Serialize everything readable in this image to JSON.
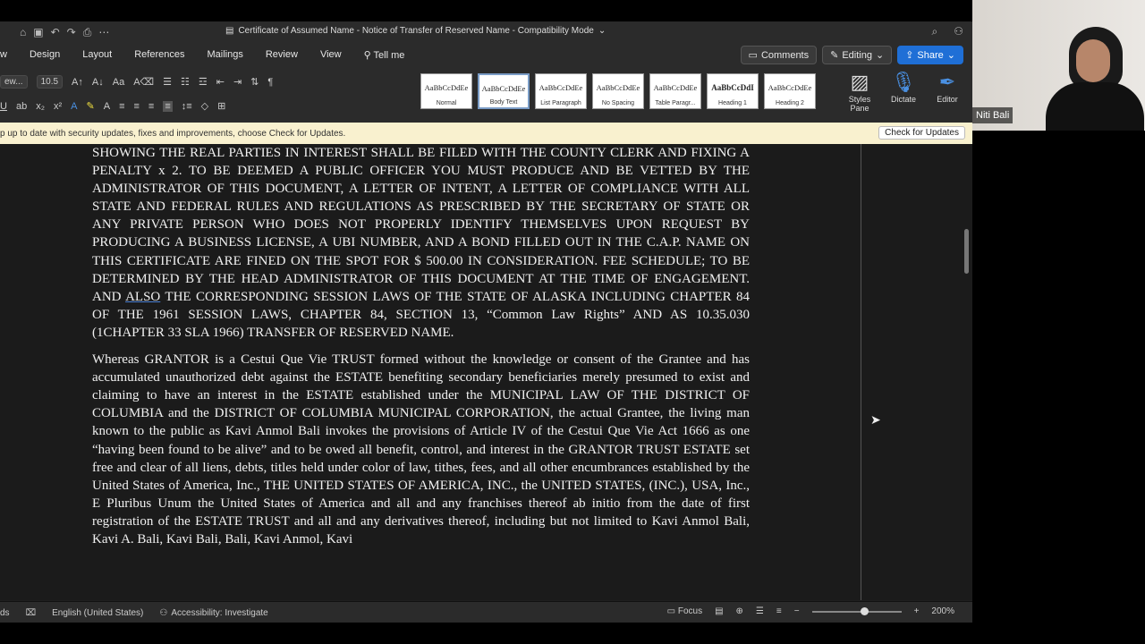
{
  "titlebar": {
    "doc_title": "Certificate of Assumed Name - Notice of Transfer of Reserved Name - Compatibility Mode",
    "title_chevron": "⌄"
  },
  "tabs": [
    "w",
    "Design",
    "Layout",
    "References",
    "Mailings",
    "Review",
    "View",
    "Tell me"
  ],
  "tab_buttons": {
    "comments": "Comments",
    "editing": "Editing",
    "share": "Share"
  },
  "ribbon": {
    "font_name": "ew...",
    "font_size": "10.5",
    "styles": [
      {
        "sample": "AaBbCcDdEe",
        "name": "Normal"
      },
      {
        "sample": "AaBbCcDdEe",
        "name": "Body Text"
      },
      {
        "sample": "AaBbCcDdEe",
        "name": "List Paragraph"
      },
      {
        "sample": "AaBbCcDdEe",
        "name": "No Spacing"
      },
      {
        "sample": "AaBbCcDdEe",
        "name": "Table Paragr..."
      },
      {
        "sample": "AaBbCcDdI",
        "name": "Heading 1"
      },
      {
        "sample": "AaBbCcDdEe",
        "name": "Heading 2"
      }
    ],
    "styles_pane": "Styles Pane",
    "dictate": "Dictate",
    "editor": "Editor"
  },
  "notice": {
    "text": "p up to date with security updates, fixes and improvements, choose Check for Updates.",
    "button": "Check for Updates"
  },
  "document": {
    "para1_a": "SHOWING THE REAL PARTIES IN INTEREST SHALL BE FILED WITH THE COUNTY CLERK AND FIXING A PENALTY x 2. TO BE DEEMED A PUBLIC OFFICER YOU MUST PRODUCE AND BE VETTED BY THE ADMINISTRATOR OF THIS DOCUMENT, A LETTER OF INTENT, A LETTER OF COMPLIANCE WITH ALL STATE AND FEDERAL RULES AND REGULATIONS AS PRESCRIBED BY THE SECRETARY OF STATE OR ANY PRIVATE PERSON WHO DOES NOT PROPERLY IDENTIFY THEMSELVES UPON REQUEST BY PRODUCING A BUSINESS LICENSE, A UBI NUMBER, AND A BOND FILLED OUT IN THE C.A.P. NAME ON THIS CERTIFICATE ARE FINED ON THE SPOT FOR $ 500.00 IN CONSIDERATION. FEE SCHEDULE; TO BE DETERMINED BY THE HEAD ADMINISTRATOR OF THIS DOCUMENT AT THE TIME OF ENGAGEMENT. AND ",
    "para1_u": "ALSO",
    "para1_b": " THE CORRESPONDING SESSION LAWS OF THE STATE OF ALASKA INCLUDING CHAPTER 84 OF THE 1961 SESSION LAWS, CHAPTER 84, SECTION 13, “Common Law Rights” AND AS 10.35.030 (1CHAPTER 33 SLA 1966) TRANSFER OF RESERVED NAME.",
    "para2": "Whereas GRANTOR is a Cestui Que Vie TRUST formed without the knowledge or consent of the Grantee and has accumulated unauthorized debt against the ESTATE benefiting secondary beneficiaries merely presumed to exist and claiming to have an interest in the ESTATE established under the MUNICIPAL LAW OF THE DISTRICT OF COLUMBIA and the DISTRICT OF COLUMBIA MUNICIPAL CORPORATION, the actual Grantee, the living man known to the public as Kavi Anmol Bali invokes the provisions of Article IV of the Cestui Que Vie Act 1666 as one “having been found to be alive” and to be owed all benefit, control, and interest in the GRANTOR TRUST ESTATE set free and clear of all liens, debts, titles held under color of law, tithes, fees, and all other encumbrances established by the United States of America, Inc., THE UNITED STATES OF AMERICA, INC., the UNITED STATES, (INC.), USA, Inc., E Pluribus Unum the United States of America and all and any franchises thereof ab initio from the date of first registration of the ESTATE TRUST and all and any derivatives thereof, including but not limited to Kavi Anmol Bali, Kavi A. Bali, Kavi Bali, Bali, Kavi Anmol, Kavi"
  },
  "status": {
    "left_clip": "ds",
    "language": "English (United States)",
    "accessibility": "Accessibility: Investigate",
    "focus": "Focus",
    "zoom": "200%",
    "zoom_level": 0.58
  },
  "video": {
    "participant_name": "Niti Bali"
  },
  "colors": {
    "share": "#1f6fd6",
    "notice_bg": "#f9f1cf"
  }
}
